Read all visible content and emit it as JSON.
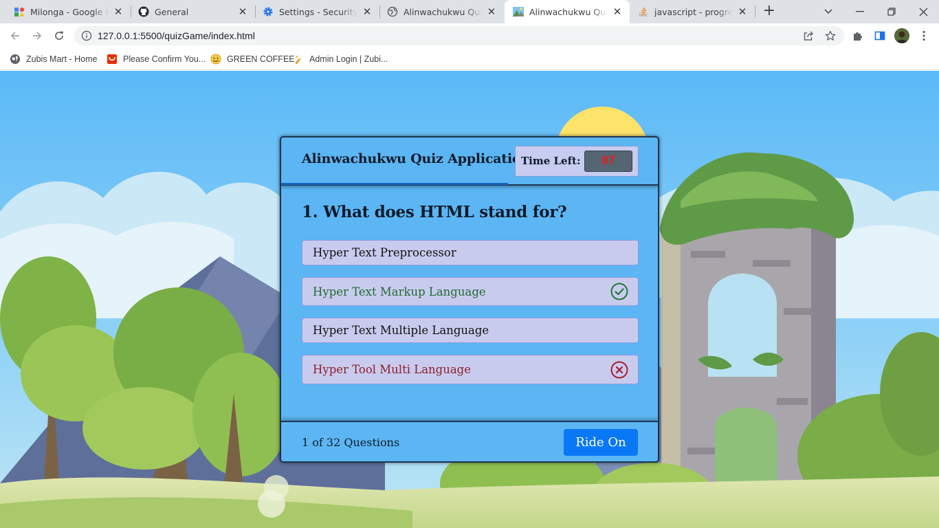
{
  "tabs": [
    {
      "title": "Milonga - Google Fon",
      "favicon": "google-fonts-icon"
    },
    {
      "title": "General",
      "favicon": "github-icon"
    },
    {
      "title": "Settings - Security",
      "favicon": "gear-icon"
    },
    {
      "title": "Alinwachukwu Quiz Ap",
      "favicon": "globe-icon"
    },
    {
      "title": "Alinwachukwu Quiz Ap",
      "favicon": "landscape-icon",
      "active": true
    },
    {
      "title": "javascript - progress b",
      "favicon": "stackoverflow-icon"
    }
  ],
  "toolbar": {
    "url": "127.0.0.1:5500/quizGame/index.html"
  },
  "bookmarks": [
    {
      "label": "Zubis Mart - Home",
      "icon": "globe-icon"
    },
    {
      "label": "Please Confirm You...",
      "icon": "shopping-bag-icon"
    },
    {
      "label": "GREEN COFFEE",
      "icon": "smiley-icon"
    },
    {
      "label": "Admin Login | Zubi...",
      "icon": "flame-icon"
    }
  ],
  "quiz": {
    "title": "Alinwachukwu Quiz Application",
    "timer_label": "Time Left:",
    "timer_seconds": "07",
    "question": "1. What does HTML stand for?",
    "options": [
      {
        "text": "Hyper Text Preprocessor",
        "state": "neutral"
      },
      {
        "text": "Hyper Text Markup Language",
        "state": "correct"
      },
      {
        "text": "Hyper Text Multiple Language",
        "state": "neutral"
      },
      {
        "text": "Hyper Tool Multi Language",
        "state": "incorrect"
      }
    ],
    "progress": "1 of 32 Questions",
    "next_label": "Ride On"
  },
  "colors": {
    "accent": "#0a78f5",
    "quiz_box": "#5cb6f3",
    "correct": "#1f6b31",
    "incorrect": "#8a1f2b",
    "timer": "#e02020"
  }
}
